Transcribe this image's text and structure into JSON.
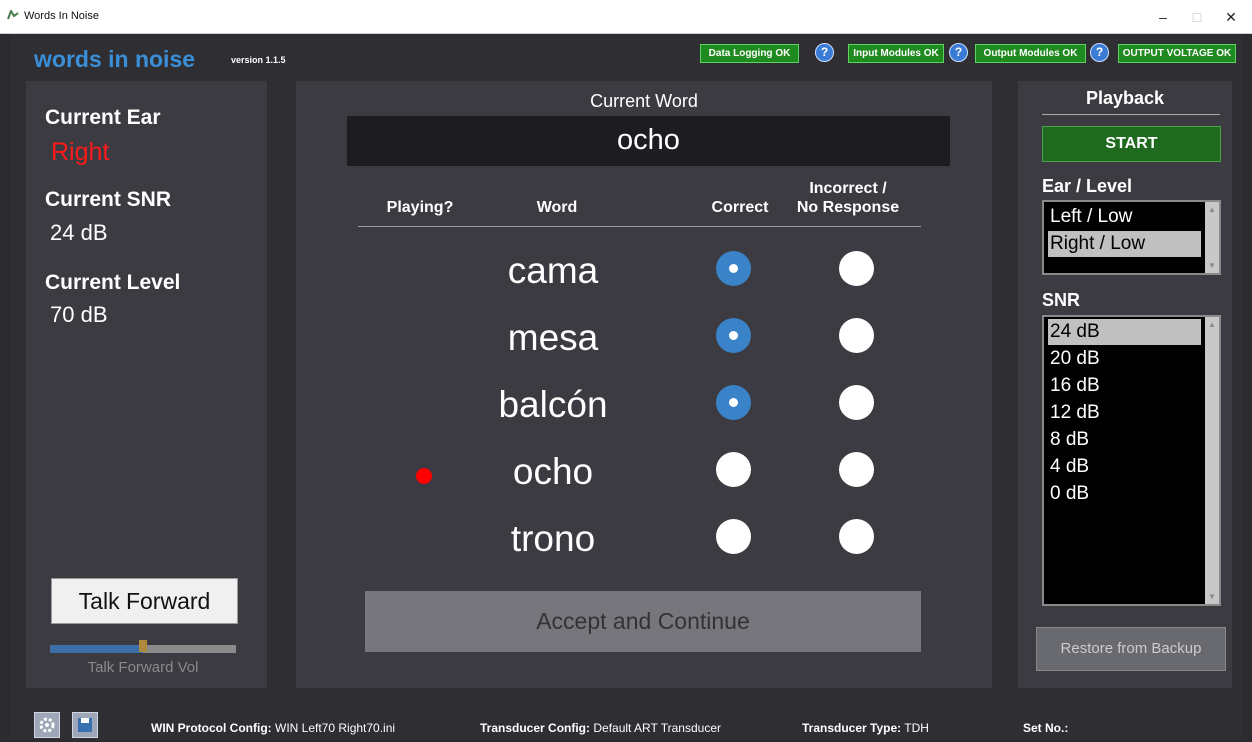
{
  "window": {
    "title": "Words In Noise",
    "minimize": "–",
    "maximize": "□",
    "close": "✕"
  },
  "header": {
    "brand": "words in noise",
    "version": "version 1.1.5"
  },
  "status": [
    {
      "label": "Data Logging OK",
      "help": "?"
    },
    {
      "label": "Input Modules OK",
      "help": "?"
    },
    {
      "label": "Output Modules OK",
      "help": "?"
    },
    {
      "label": "OUTPUT VOLTAGE OK"
    }
  ],
  "left": {
    "ear_label": "Current  Ear",
    "ear_value": "Right",
    "ear_color": "#ff1a1a",
    "snr_label": "Current SNR",
    "snr_value": "24 dB",
    "level_label": "Current Level",
    "level_value": "70 dB",
    "talk_button": "Talk Forward",
    "talk_vol_label": "Talk Forward Vol",
    "talk_vol_fraction": 0.5
  },
  "center": {
    "current_word_label": "Current  Word",
    "current_word": "ocho",
    "headers": {
      "playing": "Playing?",
      "word": "Word",
      "correct": "Correct",
      "incorrect_1": "Incorrect /",
      "incorrect_2": "No Response"
    },
    "rows": [
      {
        "word": "cama",
        "playing": false,
        "correct": true
      },
      {
        "word": "mesa",
        "playing": false,
        "correct": true
      },
      {
        "word": "balcón",
        "playing": false,
        "correct": true
      },
      {
        "word": "ocho",
        "playing": true,
        "correct": false
      },
      {
        "word": "trono",
        "playing": false,
        "correct": false
      }
    ],
    "accept_button": "Accept and Continue"
  },
  "right": {
    "playback_title": "Playback",
    "start_button": "START",
    "ear_level_label": "Ear / Level",
    "ear_level_items": [
      "Left / Low",
      "Right / Low"
    ],
    "ear_level_selected": 1,
    "snr_label": "SNR",
    "snr_items": [
      "24 dB",
      "20 dB",
      "16 dB",
      "12 dB",
      "8 dB",
      "4 dB",
      "0 dB"
    ],
    "snr_selected": 0,
    "restore_button": "Restore from Backup"
  },
  "footer": {
    "protocol_label": "WIN Protocol Config:",
    "protocol_value": "WIN Left70 Right70.ini",
    "transducer_label": "Transducer Config:",
    "transducer_value": "Default ART Transducer",
    "type_label": "Transducer Type:",
    "type_value": "TDH",
    "setno_label": "Set No.:"
  },
  "colors": {
    "brand": "#3b8fd9",
    "status_green": "#1f8a1f",
    "radio_selected": "#3a83c8",
    "playing_dot": "#ff0000"
  }
}
